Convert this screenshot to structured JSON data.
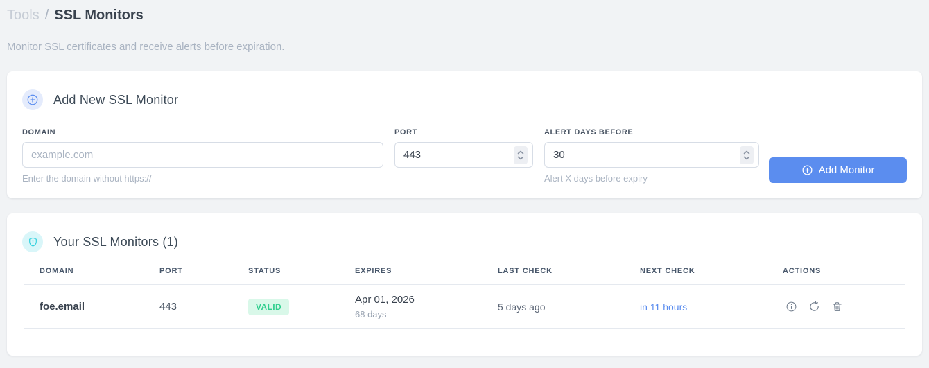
{
  "page": {
    "breadcrumb": {
      "root": "Tools",
      "separator": "/",
      "current": "SSL Monitors"
    },
    "subtitle": "Monitor SSL certificates and receive alerts before expiration."
  },
  "add_monitor_card": {
    "title": "Add New SSL Monitor",
    "icon": "plus-circle-icon",
    "fields": {
      "domain": {
        "label": "DOMAIN",
        "placeholder": "example.com",
        "value": "",
        "helper": "Enter the domain without https://"
      },
      "port": {
        "label": "PORT",
        "value": "443"
      },
      "alert_days": {
        "label": "ALERT DAYS BEFORE",
        "value": "30",
        "helper": "Alert X days before expiry"
      }
    },
    "submit_label": "Add Monitor",
    "submit_icon": "plus-circle-icon"
  },
  "monitors_card": {
    "title": "Your SSL Monitors (1)",
    "icon": "shield-icon",
    "count": 1,
    "table": {
      "headers": [
        "DOMAIN",
        "PORT",
        "STATUS",
        "EXPIRES",
        "LAST CHECK",
        "NEXT CHECK",
        "ACTIONS"
      ],
      "rows": [
        {
          "domain": "foe.email",
          "port": "443",
          "status": "VALID",
          "expires_date": "Apr 01, 2026",
          "expires_in": "68 days",
          "last_check": "5 days ago",
          "next_check": "in 11 hours",
          "actions": [
            "info-icon",
            "refresh-icon",
            "trash-icon"
          ]
        }
      ]
    }
  },
  "colors": {
    "accent_blue": "#5b8def",
    "accent_blue_bg": "#e4ebfc",
    "accent_cyan": "#2fd0dd",
    "accent_cyan_bg": "#d9f6f9",
    "status_valid_text": "#31cf8f",
    "status_valid_bg": "#d9f8e9",
    "page_bg": "#f1f3f5",
    "card_bg": "#ffffff"
  }
}
